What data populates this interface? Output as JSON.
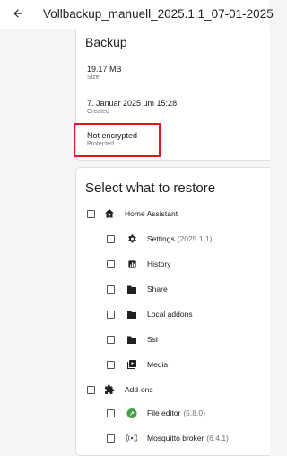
{
  "topbar": {
    "title": "Vollbackup_manuell_2025.1.1_07-01-2025"
  },
  "backup": {
    "title": "Backup",
    "size_value": "19.17 MB",
    "size_label": "Size",
    "created_value": "7. Januar 2025 um 15:28",
    "created_label": "Created",
    "protected_value": "Not encrypted",
    "protected_label": "Protected"
  },
  "restore": {
    "title": "Select what to restore",
    "home_assistant": "Home Assistant",
    "items": [
      {
        "label": "Settings",
        "version": "(2025.1.1)",
        "icon": "gear-icon"
      },
      {
        "label": "History",
        "version": "",
        "icon": "chart-icon"
      },
      {
        "label": "Share",
        "version": "",
        "icon": "folder-icon"
      },
      {
        "label": "Local addons",
        "version": "",
        "icon": "folder-icon"
      },
      {
        "label": "Ssl",
        "version": "",
        "icon": "folder-icon"
      },
      {
        "label": "Media",
        "version": "",
        "icon": "media-icon"
      }
    ],
    "addons": "Add-ons",
    "addon_items": [
      {
        "label": "File editor",
        "version": "(5.8.0)",
        "icon": "wrench-icon"
      },
      {
        "label": "Mosquitto broker",
        "version": "(6.4.1)",
        "icon": "broadcast-icon"
      }
    ]
  },
  "colors": {
    "highlight": "#e0191f",
    "file_editor_green": "#43a047"
  }
}
